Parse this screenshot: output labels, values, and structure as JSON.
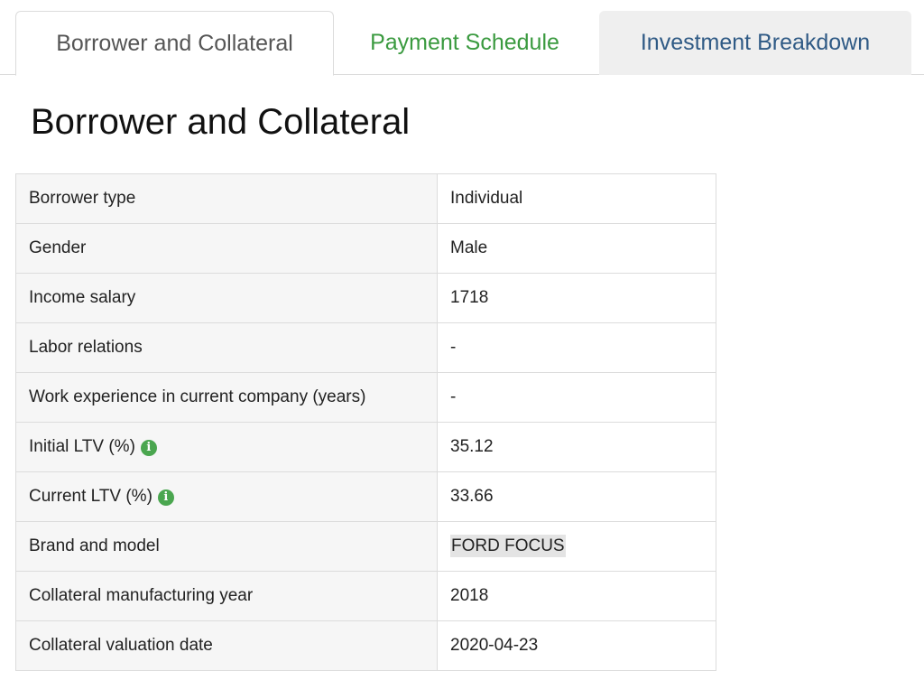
{
  "tabs": [
    {
      "label": "Borrower and Collateral"
    },
    {
      "label": "Payment Schedule"
    },
    {
      "label": "Investment Breakdown"
    }
  ],
  "section": {
    "title": "Borrower and Collateral"
  },
  "rows": [
    {
      "label": "Borrower type",
      "value": "Individual"
    },
    {
      "label": "Gender",
      "value": "Male"
    },
    {
      "label": "Income salary",
      "value": "1718"
    },
    {
      "label": "Labor relations",
      "value": "-"
    },
    {
      "label": "Work experience in current company (years)",
      "value": "-"
    },
    {
      "label": "Initial LTV (%)",
      "value": "35.12",
      "info": "i"
    },
    {
      "label": "Current LTV (%)",
      "value": "33.66",
      "info": "i"
    },
    {
      "label": "Brand and model",
      "value": "FORD FOCUS"
    },
    {
      "label": "Collateral manufacturing year",
      "value": "2018"
    },
    {
      "label": "Collateral valuation date",
      "value": "2020-04-23"
    }
  ],
  "colors": {
    "accent_green": "#3a9a3f",
    "tab_blue": "#2f5a85",
    "info_icon": "#4aa64f"
  }
}
